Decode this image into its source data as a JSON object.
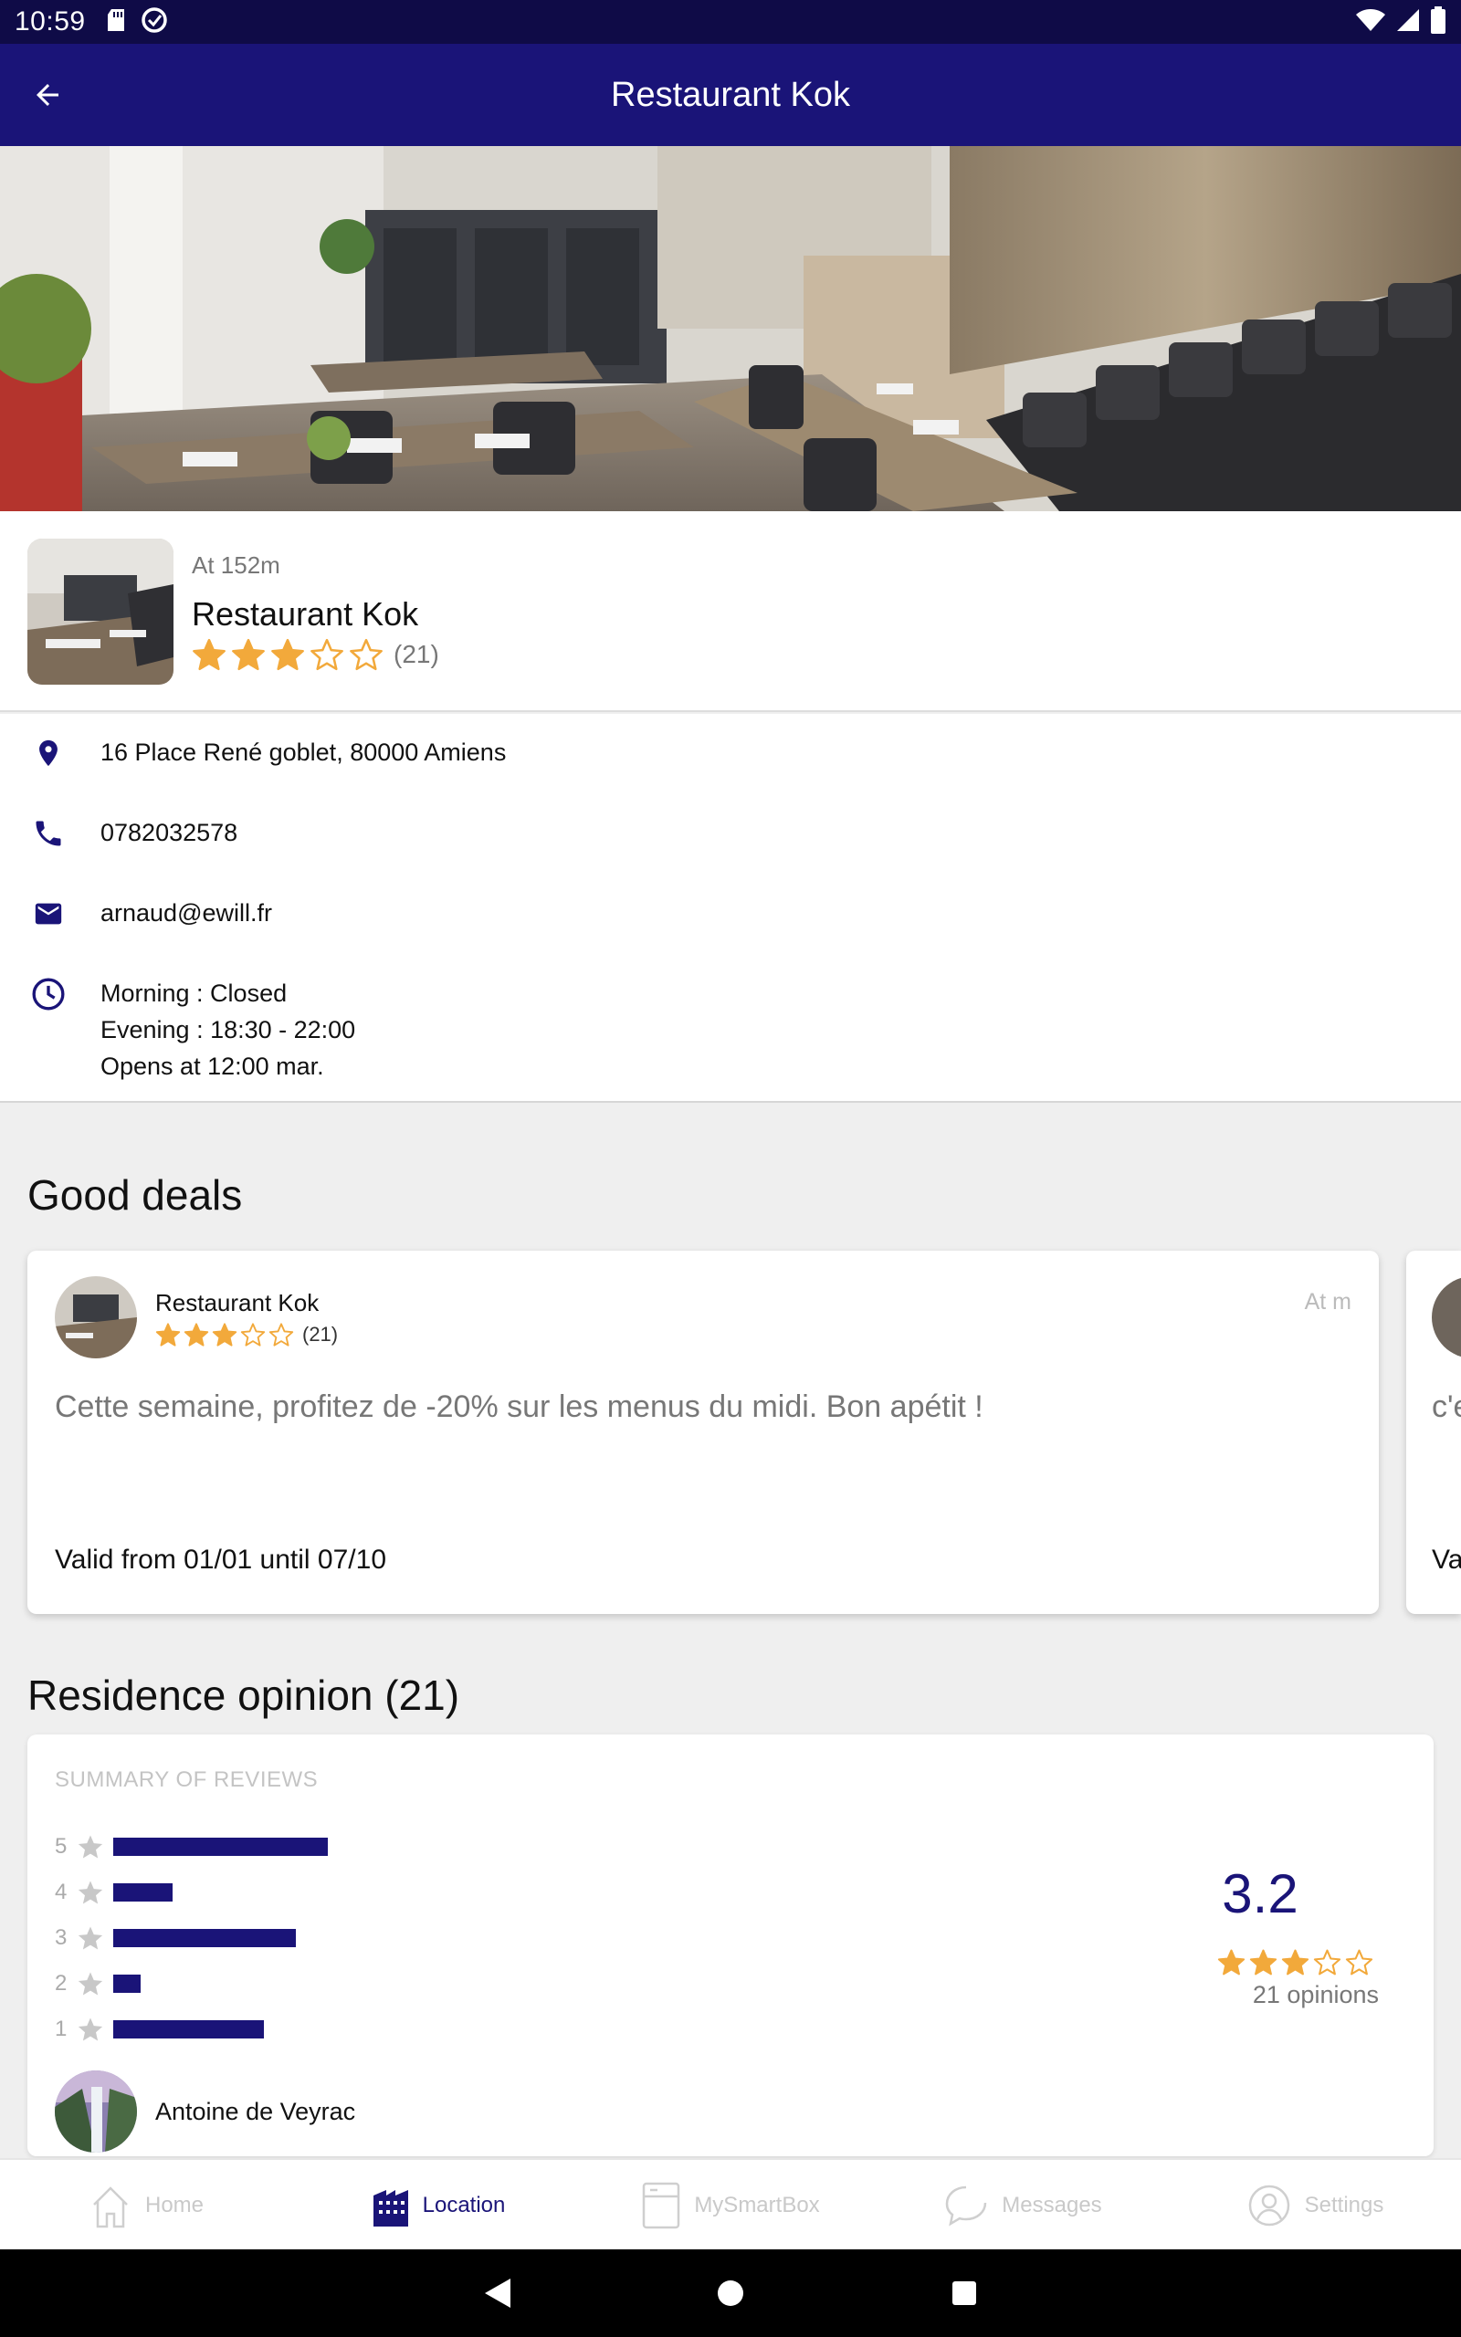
{
  "status_bar": {
    "time": "10:59"
  },
  "app_bar": {
    "title": "Restaurant Kok"
  },
  "header": {
    "distance": "At 152m",
    "name": "Restaurant Kok",
    "rating_stars": 3,
    "review_count": "(21)"
  },
  "contact": {
    "address": "16 Place René goblet, 80000 Amiens",
    "phone": "0782032578",
    "email": "arnaud@ewill.fr",
    "hours": [
      "Morning : Closed",
      "Evening : 18:30 - 22:00",
      "Opens at 12:00 mar."
    ]
  },
  "good_deals": {
    "title": "Good deals",
    "cards": [
      {
        "name": "Restaurant Kok",
        "rating_stars": 3,
        "review_count": "(21)",
        "distance": "At m",
        "description": "Cette semaine, profitez de -20% sur les menus du midi. Bon apétit !",
        "validity": "Valid from 01/01 until 07/10"
      },
      {
        "description_partial": "c'e",
        "validity_partial": "Va"
      }
    ]
  },
  "reviews": {
    "title": "Residence opinion (21)",
    "summary_label": "SUMMARY OF REVIEWS",
    "distribution": [
      {
        "stars": "5",
        "fraction": 0.47
      },
      {
        "stars": "4",
        "fraction": 0.13
      },
      {
        "stars": "3",
        "fraction": 0.4
      },
      {
        "stars": "2",
        "fraction": 0.06
      },
      {
        "stars": "1",
        "fraction": 0.33
      }
    ],
    "average": "3.2",
    "average_stars": 3,
    "opinions": "21 opinions",
    "first_reviewer": "Antoine de Veyrac"
  },
  "bottom_nav": {
    "items": [
      {
        "label": "Home",
        "icon": "home-icon"
      },
      {
        "label": "Location",
        "icon": "building-icon",
        "active": true
      },
      {
        "label": "MySmartBox",
        "icon": "box-icon"
      },
      {
        "label": "Messages",
        "icon": "chat-icon"
      },
      {
        "label": "Settings",
        "icon": "person-icon"
      }
    ]
  },
  "colors": {
    "primary": "#1a1478",
    "statusbar": "#0f0b47",
    "star": "#f2a93b",
    "background": "#efefef"
  }
}
